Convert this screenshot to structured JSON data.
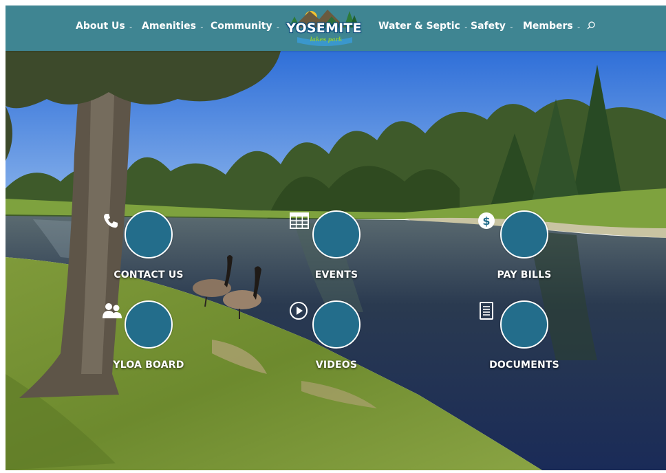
{
  "nav": {
    "left": [
      {
        "label": "About Us",
        "icon": "chevron-down-icon"
      },
      {
        "label": "Amenities",
        "icon": "chevron-down-icon"
      },
      {
        "label": "Community",
        "icon": "chevron-down-icon"
      }
    ],
    "right": [
      {
        "label": "Water & Septic",
        "icon": "chevron-down-icon"
      },
      {
        "label": "Safety",
        "icon": "chevron-down-icon"
      },
      {
        "label": "Members",
        "icon": "chevron-down-icon"
      }
    ],
    "search_icon": "search-icon"
  },
  "logo": {
    "title": "YOSEMITE",
    "subtitle": "lakes park"
  },
  "tiles": [
    {
      "label": "CONTACT US",
      "icon": "phone-icon"
    },
    {
      "label": "EVENTS",
      "icon": "calendar-icon"
    },
    {
      "label": "PAY BILLS",
      "icon": "dollar-icon"
    },
    {
      "label": "YLOA BOARD",
      "icon": "people-icon"
    },
    {
      "label": "VIDEOS",
      "icon": "play-icon"
    },
    {
      "label": "DOCUMENTS",
      "icon": "document-icon"
    }
  ],
  "colors": {
    "header": "#3f8592",
    "tile_circle": "#236d8b"
  }
}
